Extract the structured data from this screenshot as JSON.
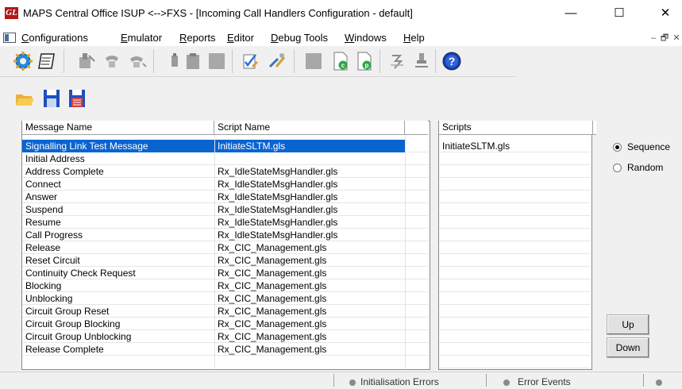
{
  "window": {
    "logo": "GL",
    "title": "MAPS Central Office ISUP <-->FXS - [Incoming Call Handlers Configuration - default]",
    "minimize": "—",
    "maximize": "☐",
    "close": "✕"
  },
  "menu": {
    "items": [
      {
        "mnemonic": "C",
        "rest": "onfigurations"
      },
      {
        "mnemonic": "E",
        "rest": "mulator"
      },
      {
        "mnemonic": "R",
        "rest": "eports"
      },
      {
        "mnemonic": "E",
        "rest": "ditor"
      },
      {
        "mnemonic": "D",
        "rest": "ebug Tools"
      },
      {
        "mnemonic": "W",
        "rest": "indows"
      },
      {
        "mnemonic": "H",
        "rest": "elp"
      }
    ],
    "mdi_minimize": "–",
    "mdi_restore": "🗗",
    "mdi_close": "✕"
  },
  "toolbar": {
    "icons": [
      "gear-icon",
      "notebook-icon",
      "cut-phone-icon",
      "phone-dim-icon",
      "phone-call-icon",
      "phone-gray-icon",
      "clipboard-icon",
      "blank-gray-icon",
      "checklist-icon",
      "tools-icon",
      "blank-gray-icon-2",
      "document-green-icon",
      "document-p-icon",
      "signal-icon",
      "usb-icon",
      "help-icon"
    ]
  },
  "message_table": {
    "headers": [
      "Message Name",
      "Script Name",
      ""
    ],
    "rows": [
      {
        "message": "Signalling Link Test Message",
        "script": "InitiateSLTM.gls",
        "selected": true
      },
      {
        "message": "Initial Address",
        "script": ""
      },
      {
        "message": "Address Complete",
        "script": "Rx_IdleStateMsgHandler.gls"
      },
      {
        "message": "Connect",
        "script": "Rx_IdleStateMsgHandler.gls"
      },
      {
        "message": "Answer",
        "script": "Rx_IdleStateMsgHandler.gls"
      },
      {
        "message": "Suspend",
        "script": "Rx_IdleStateMsgHandler.gls"
      },
      {
        "message": "Resume",
        "script": "Rx_IdleStateMsgHandler.gls"
      },
      {
        "message": "Call Progress",
        "script": "Rx_IdleStateMsgHandler.gls"
      },
      {
        "message": "Release",
        "script": "Rx_CIC_Management.gls"
      },
      {
        "message": "Reset Circuit",
        "script": "Rx_CIC_Management.gls"
      },
      {
        "message": "Continuity Check Request",
        "script": "Rx_CIC_Management.gls"
      },
      {
        "message": "Blocking",
        "script": "Rx_CIC_Management.gls"
      },
      {
        "message": "Unblocking",
        "script": "Rx_CIC_Management.gls"
      },
      {
        "message": "Circuit Group Reset",
        "script": "Rx_CIC_Management.gls"
      },
      {
        "message": "Circuit Group Blocking",
        "script": "Rx_CIC_Management.gls"
      },
      {
        "message": "Circuit Group Unblocking",
        "script": "Rx_CIC_Management.gls"
      },
      {
        "message": "Release Complete",
        "script": "Rx_CIC_Management.gls"
      }
    ]
  },
  "scripts_table": {
    "headers": [
      "Scripts",
      ""
    ],
    "rows": [
      "InitiateSLTM.gls"
    ]
  },
  "order": {
    "sequence_label": "Sequence",
    "random_label": "Random",
    "selected": "sequence"
  },
  "buttons": {
    "up": "Up",
    "down": "Down"
  },
  "status": {
    "init_errors": "Initialisation Errors",
    "error_events": "Error Events"
  },
  "colors": {
    "selection": "#0a64d0",
    "logo": "#b01818",
    "save_blue": "#1e4fbf"
  }
}
